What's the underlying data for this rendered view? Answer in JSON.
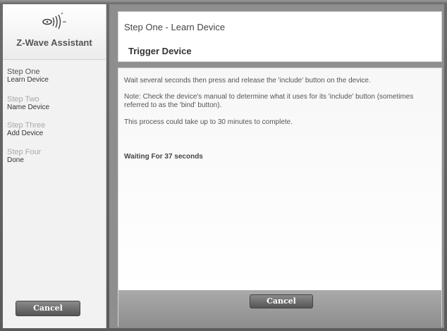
{
  "sidebar": {
    "brand_title": "Z-Wave Assistant",
    "steps": [
      {
        "title": "Step One",
        "subtitle": "Learn Device",
        "state": "active"
      },
      {
        "title": "Step Two",
        "subtitle": "Name Device",
        "state": "inactive"
      },
      {
        "title": "Step Three",
        "subtitle": "Add Device",
        "state": "inactive"
      },
      {
        "title": "Step Four",
        "subtitle": "Done",
        "state": "inactive"
      }
    ],
    "cancel_label": "Cancel"
  },
  "header": {
    "step_title": "Step One - Learn Device",
    "subtitle": "Trigger Device"
  },
  "content": {
    "instruction": "Wait several seconds then press and release the 'include' button on the device.",
    "note": "Note: Check the device's manual to determine what it uses for its 'include' button (sometimes referred to as the 'bind' button).",
    "duration": "This process could take up to 30 minutes to complete.",
    "waiting": "Waiting For 37 seconds"
  },
  "footer": {
    "cancel_label": "Cancel"
  },
  "colors": {
    "frame": "#5a5a5a",
    "sidebar": "#f2f2f2",
    "footer": "#8e8e8e",
    "button": "#555555"
  },
  "icons": {
    "brand": "z-wave-antenna-icon"
  }
}
